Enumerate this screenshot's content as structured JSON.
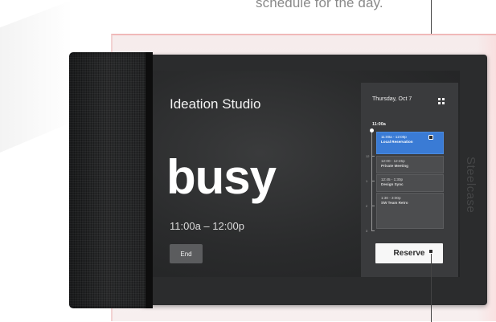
{
  "annotation": {
    "text": "schedule for the day."
  },
  "brand": {
    "name": "Steelcase"
  },
  "room": {
    "name": "Ideation Studio",
    "status": "busy",
    "time_range": "11:00a – 12:00p",
    "end_label": "End"
  },
  "calendar": {
    "date": "Thursday, Oct 7",
    "now_label": "11:00a",
    "ticks": [
      "12",
      "1",
      "2",
      "3"
    ],
    "events": [
      {
        "time": "11:00a - 12:00p",
        "name": "Local Reservation",
        "active": true
      },
      {
        "time": "12:00 - 12:45p",
        "name": "Private Meeting",
        "active": false
      },
      {
        "time": "12:45 - 1:30p",
        "name": "Design Sync",
        "active": false
      },
      {
        "time": "1:30 - 3:00p",
        "name": "SW Team Retro",
        "active": false
      }
    ],
    "reserve_label": "Reserve",
    "grid_icon": "grid-icon"
  },
  "colors": {
    "accent": "#3a7bd5",
    "screen": "#2a2b2c",
    "panel": "#3a3b3d"
  }
}
